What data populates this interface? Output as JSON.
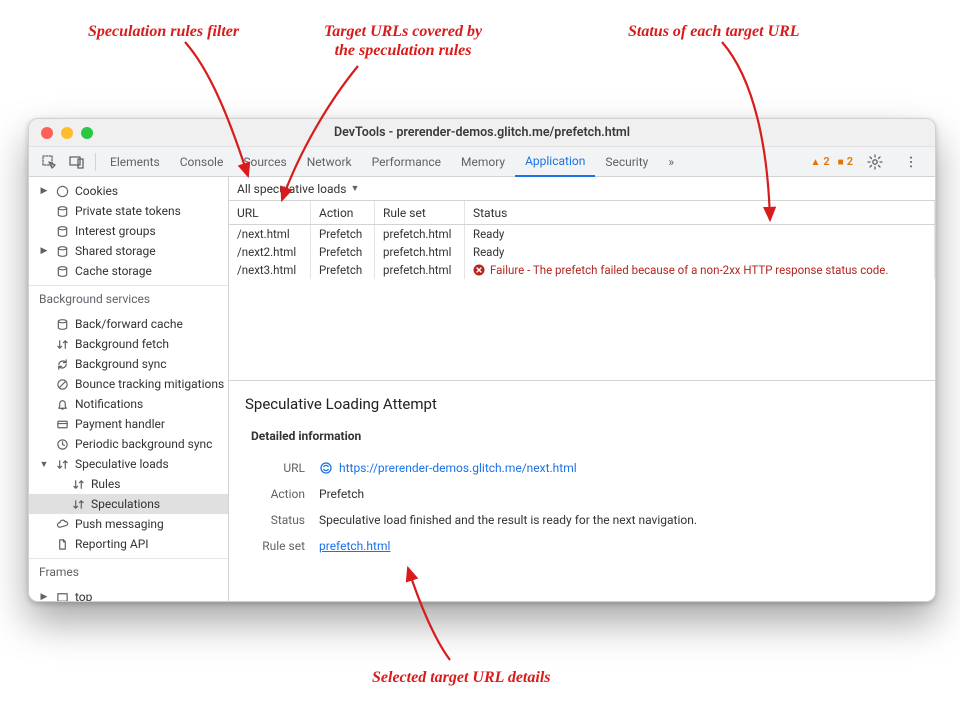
{
  "annotations": {
    "filter": "Speculation rules filter",
    "targets_l1": "Target URLs covered by",
    "targets_l2": "the speculation rules",
    "status": "Status of each target URL",
    "details": "Selected target URL details"
  },
  "window": {
    "title": "DevTools - prerender-demos.glitch.me/prefetch.html"
  },
  "tabs": {
    "elements": "Elements",
    "console": "Console",
    "sources": "Sources",
    "network": "Network",
    "performance": "Performance",
    "memory": "Memory",
    "application": "Application",
    "security": "Security",
    "more": "»"
  },
  "warnings": {
    "triangle": "2",
    "square": "2"
  },
  "sidebar": {
    "storage": {
      "cookies": "Cookies",
      "pst": "Private state tokens",
      "interest": "Interest groups",
      "shared": "Shared storage",
      "cache": "Cache storage"
    },
    "bg_heading": "Background services",
    "bg": {
      "bf": "Back/forward cache",
      "bgfetch": "Background fetch",
      "bgsync": "Background sync",
      "bounce": "Bounce tracking mitigations",
      "notif": "Notifications",
      "payment": "Payment handler",
      "periodic": "Periodic background sync",
      "specloads": "Speculative loads",
      "rules": "Rules",
      "specs": "Speculations",
      "push": "Push messaging",
      "reporting": "Reporting API"
    },
    "frames_heading": "Frames",
    "frames": {
      "top": "top"
    }
  },
  "filter": {
    "label": "All speculative loads"
  },
  "grid": {
    "headers": {
      "url": "URL",
      "action": "Action",
      "ruleset": "Rule set",
      "status": "Status"
    },
    "rows": [
      {
        "url": "/next.html",
        "action": "Prefetch",
        "ruleset": "prefetch.html",
        "status": "Ready",
        "failure": false
      },
      {
        "url": "/next2.html",
        "action": "Prefetch",
        "ruleset": "prefetch.html",
        "status": "Ready",
        "failure": false
      },
      {
        "url": "/next3.html",
        "action": "Prefetch",
        "ruleset": "prefetch.html",
        "status": "Failure - The prefetch failed because of a non-2xx HTTP response status code.",
        "failure": true
      }
    ]
  },
  "detail": {
    "title": "Speculative Loading Attempt",
    "subheading": "Detailed information",
    "labels": {
      "url": "URL",
      "action": "Action",
      "status": "Status",
      "ruleset": "Rule set"
    },
    "url": "https://prerender-demos.glitch.me/next.html",
    "action": "Prefetch",
    "status": "Speculative load finished and the result is ready for the next navigation.",
    "ruleset": "prefetch.html"
  }
}
